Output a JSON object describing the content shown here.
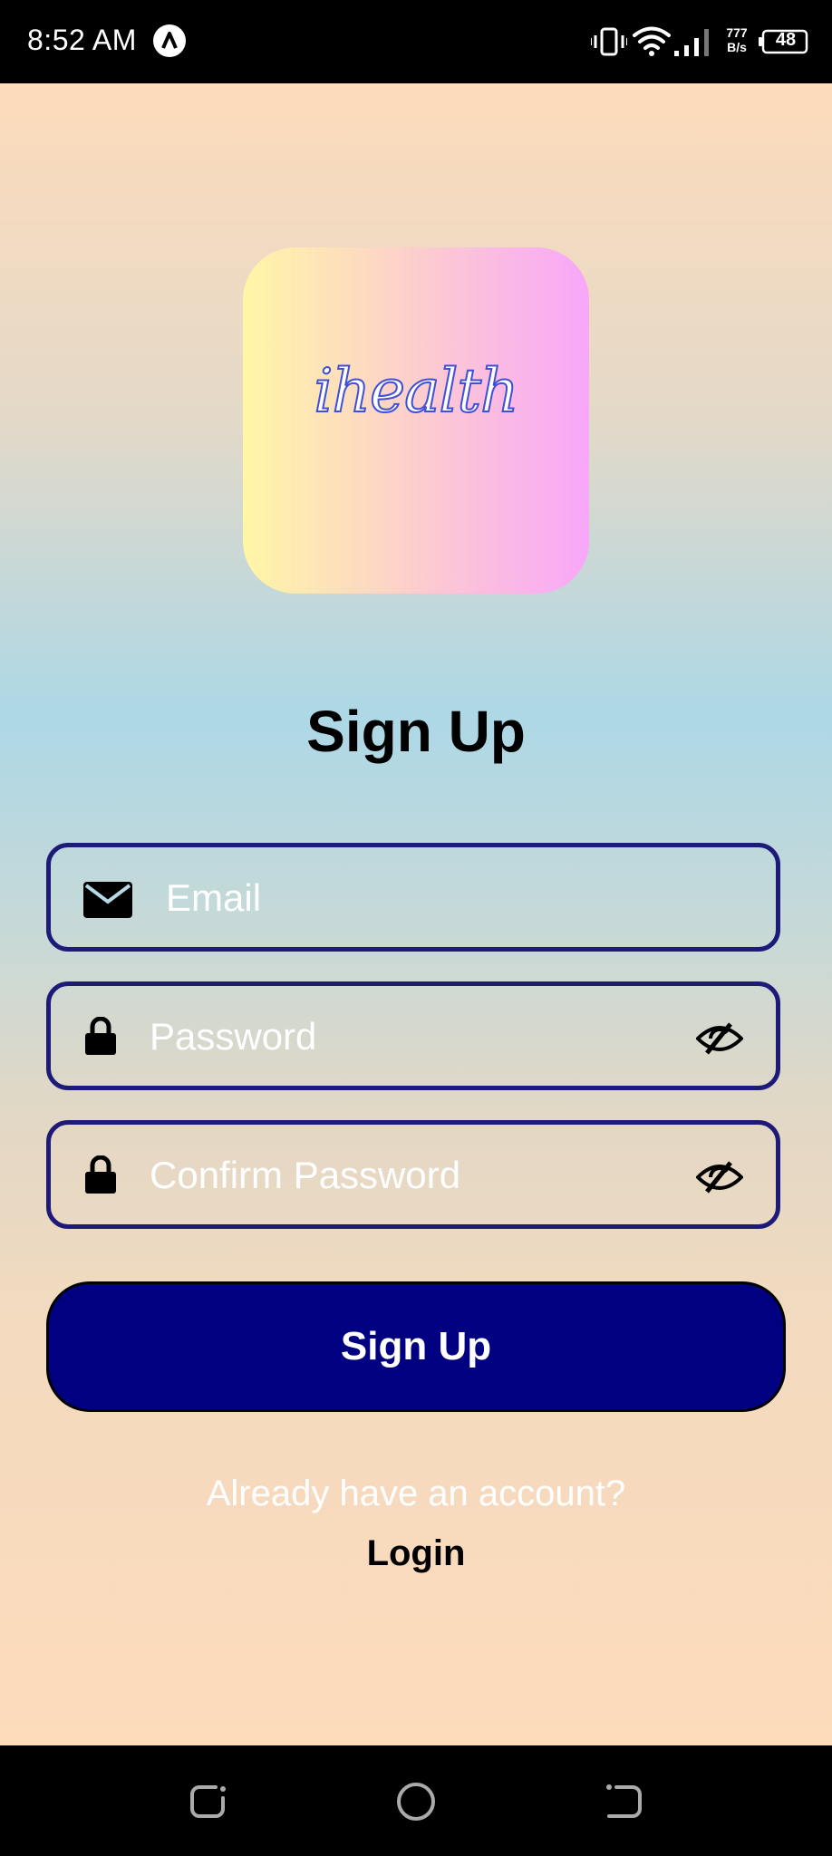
{
  "status_bar": {
    "time": "8:52 AM",
    "net_speed_value": "777",
    "net_speed_unit": "B/s",
    "battery": "48"
  },
  "logo": {
    "text": "ihealth"
  },
  "title": "Sign Up",
  "fields": {
    "email_placeholder": "Email",
    "password_placeholder": "Password",
    "confirm_placeholder": "Confirm Password"
  },
  "signup_button": "Sign Up",
  "already_text": "Already have an account?",
  "login_link": "Login",
  "colors": {
    "button_bg": "#000080",
    "field_border": "#1d1a78",
    "logo_gradient_start": "#fff6a6",
    "logo_gradient_end": "#f8a7f9"
  }
}
